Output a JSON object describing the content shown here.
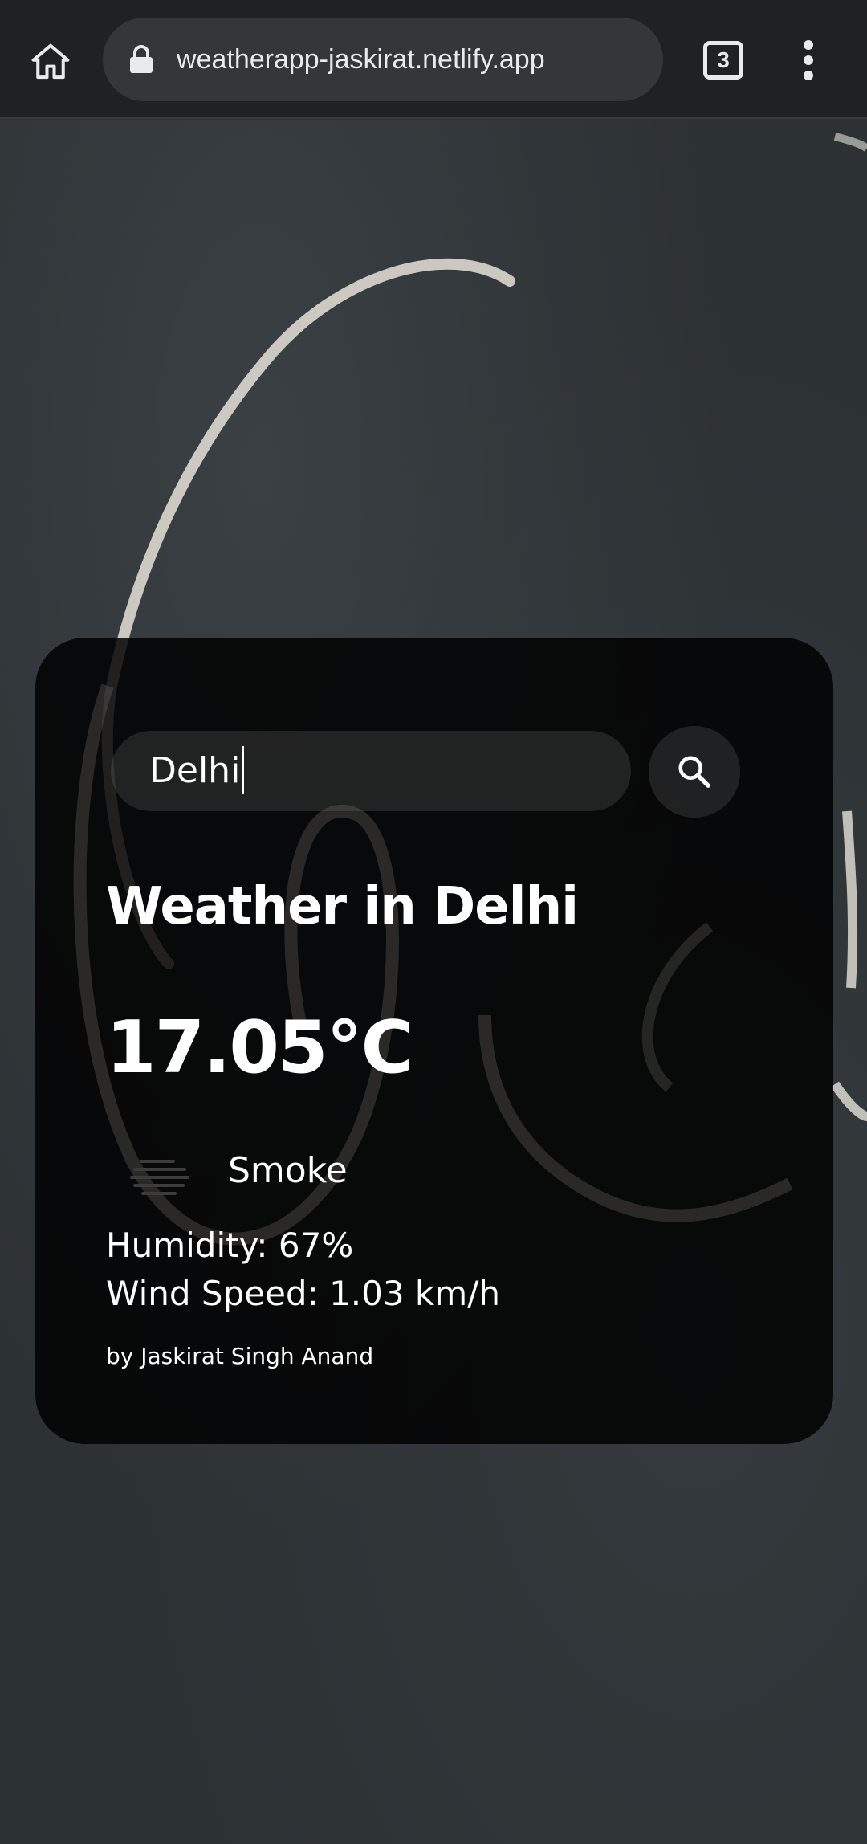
{
  "browser": {
    "url": "weatherapp-jaskirat.netlify.app",
    "tab_count": "3"
  },
  "weather": {
    "search_value": "Delhi",
    "title": "Weather in Delhi",
    "temperature": "17.05°C",
    "description": "Smoke",
    "humidity": "Humidity: 67%",
    "wind": "Wind Speed: 1.03 km/h",
    "credit": "by Jaskirat Singh Anand",
    "icon": "smoke-haze-icon"
  },
  "colors": {
    "browser_bar": "#202124",
    "url_pill": "#35363a",
    "text": "#ffffff",
    "card": "rgba(0,0,0,0.84)"
  }
}
